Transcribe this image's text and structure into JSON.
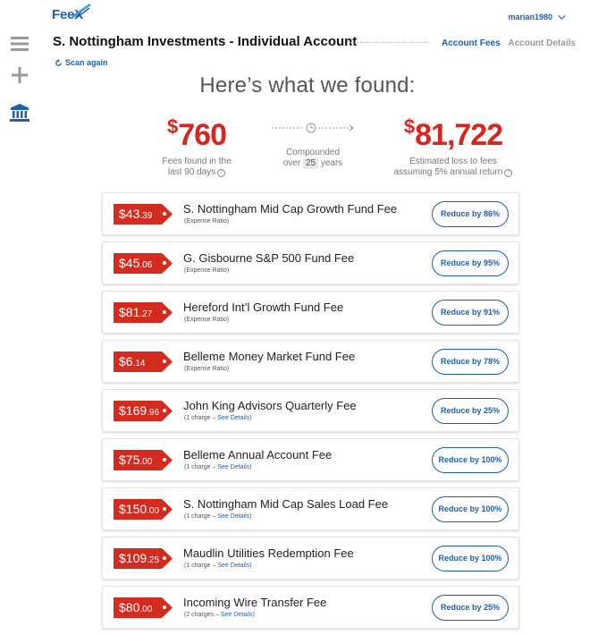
{
  "brand": {
    "logo": "FeeX",
    "accent": "#1f5fa8",
    "fee_red": "#d42b1f"
  },
  "user": {
    "name": "marian1980",
    "menu_icon": "chevron-down-icon"
  },
  "sidebar": {
    "icons": [
      "menu-icon",
      "add-icon",
      "bank-icon"
    ]
  },
  "account": {
    "title": "S. Nottingham Investments - Individual Account"
  },
  "tabs": [
    {
      "label": "Account Fees",
      "active": true
    },
    {
      "label": "Account Details",
      "active": false
    }
  ],
  "scan": {
    "label": "Scan again"
  },
  "headline": "Here’s what we found:",
  "summary": {
    "fees": {
      "value": "760",
      "currency": "$",
      "caption_line1": "Fees found in the",
      "caption_line2": "last 90 days"
    },
    "compound": {
      "line1": "Compounded",
      "line2_prefix": "over",
      "years": "25",
      "line2_suffix": "years"
    },
    "loss": {
      "value": "81,722",
      "currency": "$",
      "caption_line1": "Estimated loss to fees",
      "caption_line2": "assuming 5% annual return"
    }
  },
  "fees": [
    {
      "dollars": "$43",
      "cents": ".39",
      "name": "S. Nottingham Mid Cap Growth Fund Fee",
      "sub": "(Expense Ratio)",
      "link": "",
      "sub_end": "",
      "button": "Reduce by 86%"
    },
    {
      "dollars": "$45",
      "cents": ".06",
      "name": "G. Gisbourne S&P 500 Fund Fee",
      "sub": "(Expense Ratio)",
      "link": "",
      "sub_end": "",
      "button": "Reduce by 95%"
    },
    {
      "dollars": "$81",
      "cents": ".27",
      "name": "Hereford Int’l Growth Fund Fee",
      "sub": "(Expense Ratio)",
      "link": "",
      "sub_end": "",
      "button": "Reduce by 91%"
    },
    {
      "dollars": "$6",
      "cents": ".14",
      "name": "Belleme Money Market Fund Fee",
      "sub": "(Expense Ratio)",
      "link": "",
      "sub_end": "",
      "button": "Reduce by 78%"
    },
    {
      "dollars": "$169",
      "cents": ".96",
      "name": "John King Advisors Quarterly Fee",
      "sub": "(1 charge – ",
      "link": "See Details",
      "sub_end": ")",
      "button": "Reduce by 25%"
    },
    {
      "dollars": "$75",
      "cents": ".00",
      "name": "Belleme Annual Account Fee",
      "sub": "(1 charge – ",
      "link": "See Details",
      "sub_end": ")",
      "button": "Reduce by 100%"
    },
    {
      "dollars": "$150",
      "cents": ".00",
      "name": "S. Nottingham Mid Cap Sales Load Fee",
      "sub": "(1 charge – ",
      "link": "See Details",
      "sub_end": ")",
      "button": "Reduce by 100%"
    },
    {
      "dollars": "$109",
      "cents": ".25",
      "name": "Maudlin Utilities Redemption Fee",
      "sub": "(1 charge – ",
      "link": "See Details",
      "sub_end": ")",
      "button": "Reduce by 100%"
    },
    {
      "dollars": "$80",
      "cents": ".00",
      "name": "Incoming Wire Transfer Fee",
      "sub": "(2 charges – ",
      "link": "See Details",
      "sub_end": ")",
      "button": "Reduce by 25%"
    }
  ]
}
